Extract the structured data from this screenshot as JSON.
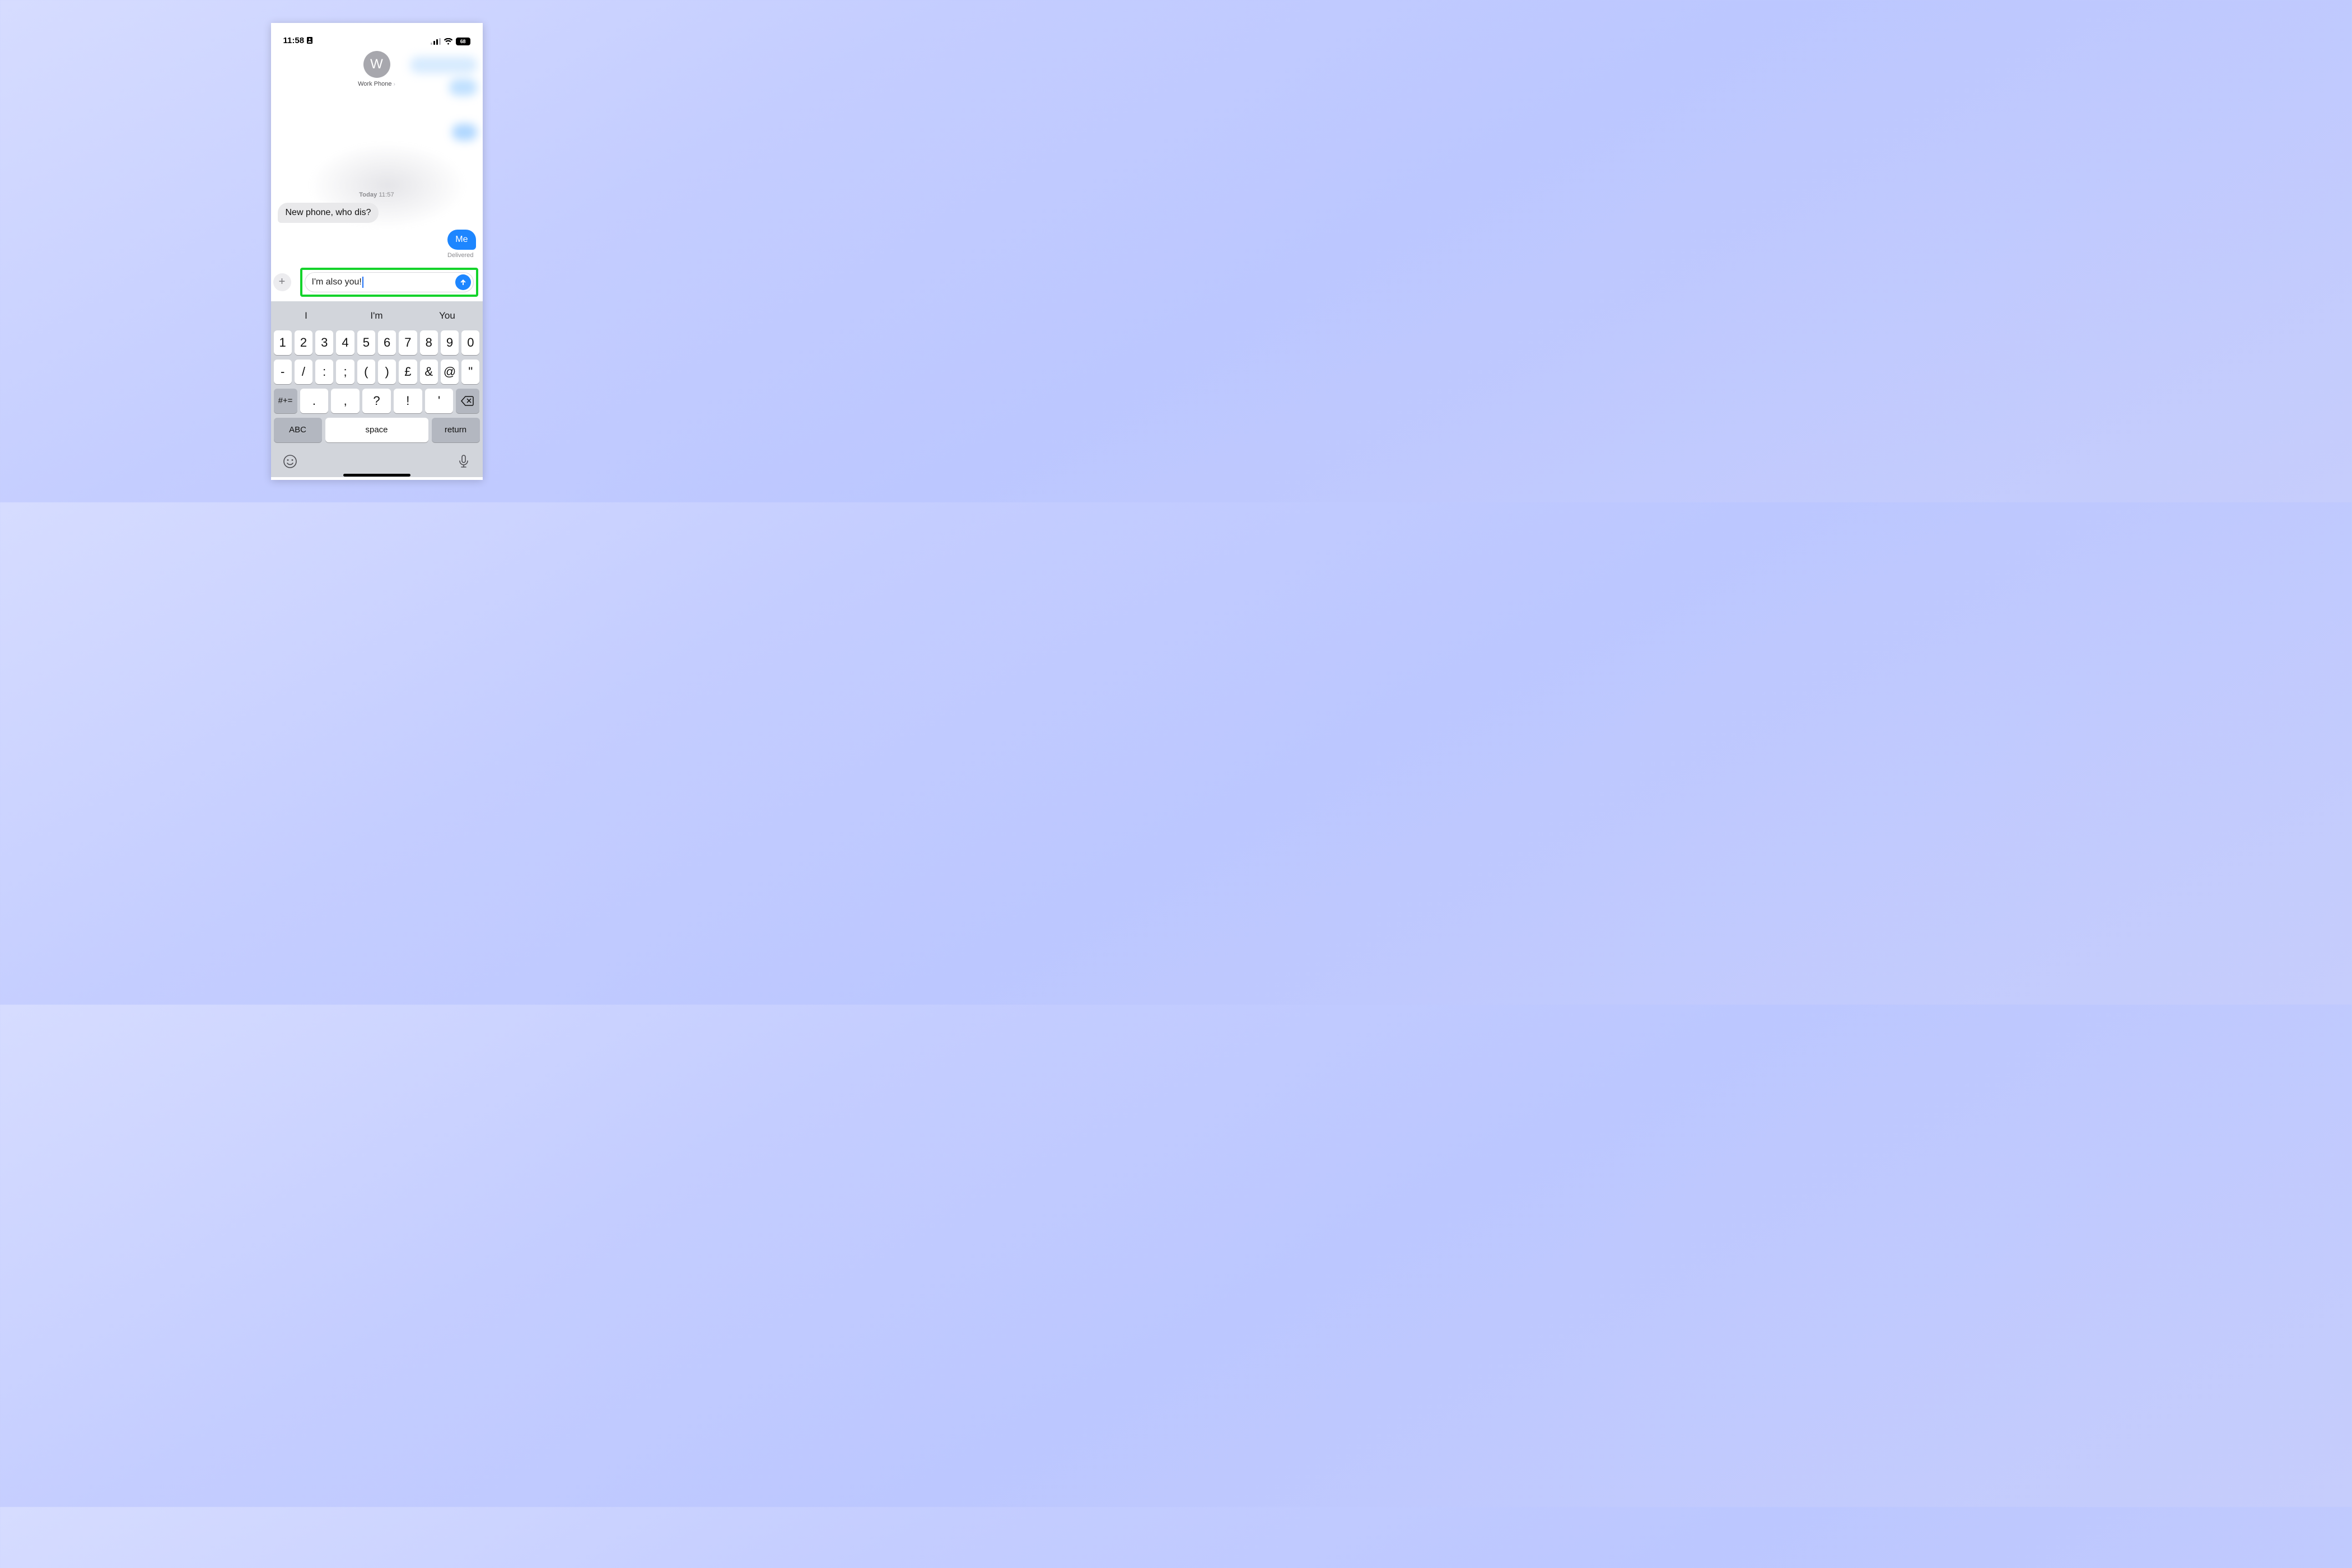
{
  "status": {
    "time": "11:58",
    "battery": "68"
  },
  "header": {
    "avatar_initial": "W",
    "contact_name": "Work Phone"
  },
  "conversation": {
    "timestamp_day": "Today",
    "timestamp_time": "11:57",
    "incoming_1": "New phone, who dis?",
    "outgoing_1": "Me",
    "delivered_label": "Delivered"
  },
  "compose": {
    "draft_text": "I'm also you!",
    "plus": "+"
  },
  "suggestions": {
    "s1": "I",
    "s2": "I'm",
    "s3": "You"
  },
  "keyboard": {
    "row1": {
      "k1": "1",
      "k2": "2",
      "k3": "3",
      "k4": "4",
      "k5": "5",
      "k6": "6",
      "k7": "7",
      "k8": "8",
      "k9": "9",
      "k10": "0"
    },
    "row2": {
      "k1": "-",
      "k2": "/",
      "k3": ":",
      "k4": ";",
      "k5": "(",
      "k6": ")",
      "k7": "£",
      "k8": "&",
      "k9": "@",
      "k10": "\""
    },
    "row3": {
      "numsym": "#+=",
      "k1": ".",
      "k2": ",",
      "k3": "?",
      "k4": "!",
      "k5": "'"
    },
    "row4": {
      "abc": "ABC",
      "space": "space",
      "ret": "return"
    }
  }
}
